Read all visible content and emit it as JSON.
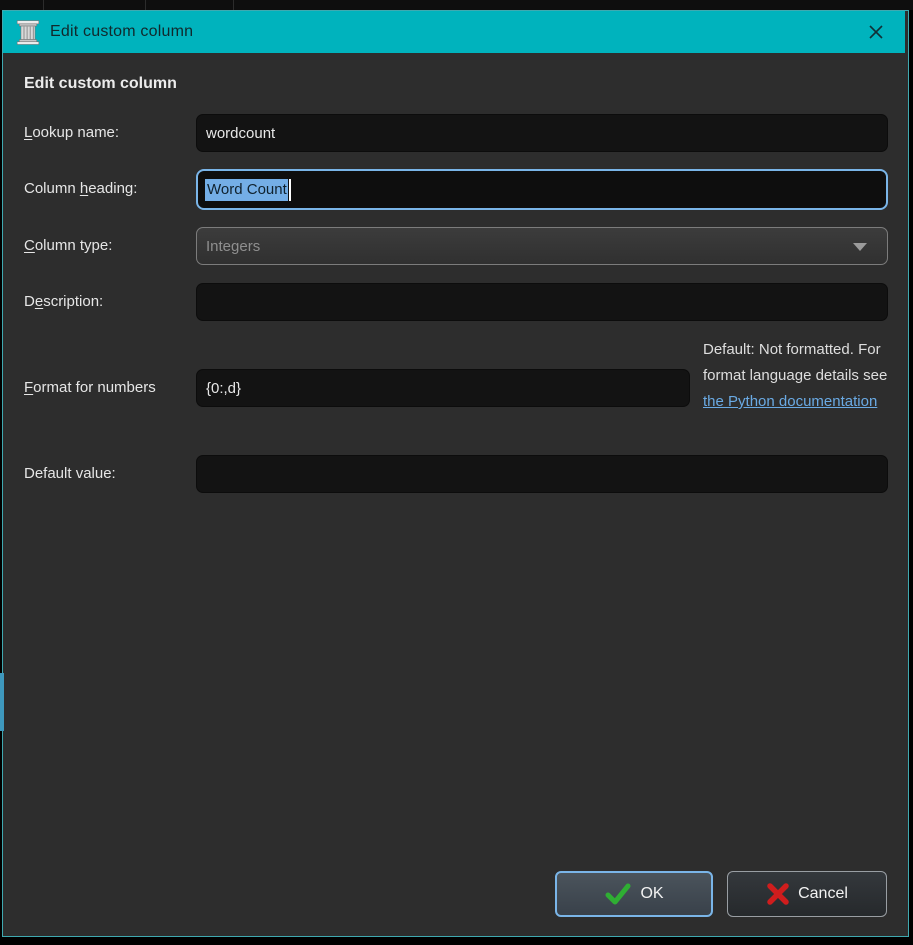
{
  "titlebar": {
    "title": "Edit custom column"
  },
  "heading": "Edit custom column",
  "fields": {
    "lookup": {
      "pre": "",
      "key": "L",
      "post": "ookup name:",
      "value": "wordcount"
    },
    "column_heading": {
      "pre": "Column ",
      "key": "h",
      "post": "eading:",
      "value": "Word Count"
    },
    "column_type": {
      "pre": "",
      "key": "C",
      "post": "olumn type:",
      "value": "Integers"
    },
    "description": {
      "pre": "D",
      "key": "e",
      "post": "scription:",
      "value": ""
    },
    "format": {
      "pre": "",
      "key": "F",
      "post": "ormat for numbers",
      "value": "{0:,d}"
    },
    "default_value": {
      "pre": "Default value:",
      "key": "",
      "post": "",
      "value": ""
    }
  },
  "format_help": {
    "text": "Default: Not formatted. For format language details see ",
    "link": "the Python documentation"
  },
  "buttons": {
    "ok": "OK",
    "cancel": "Cancel"
  },
  "colors": {
    "titlebar": "#00b3bd",
    "focus": "#7ab5e8",
    "selection": "#74aee6",
    "selection_text": "#10222e",
    "link": "#6aaae4",
    "ok_check": "#2fae33",
    "cancel_x": "#d01d1d",
    "dialog_bg": "#2d2d2d",
    "input_bg": "#131313",
    "window_border": "#3fa9b0"
  }
}
